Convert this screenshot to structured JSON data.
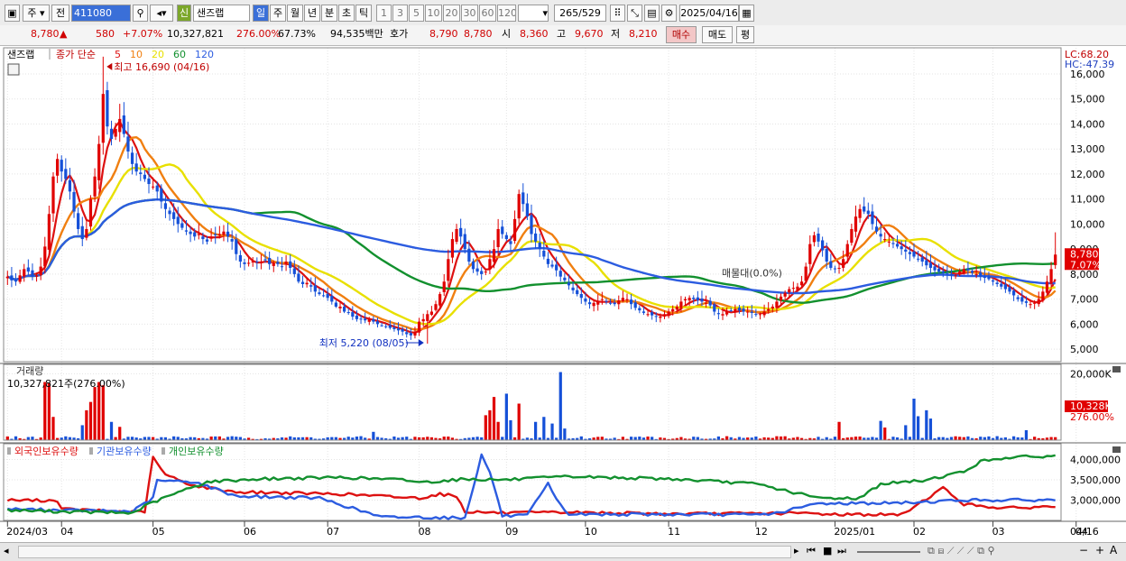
{
  "toolbar": {
    "market_label": "주",
    "prev_label": "전",
    "code": "411080",
    "new_badge": "신",
    "stock_name": "샌즈랩",
    "periods": [
      "일",
      "주",
      "월",
      "년",
      "분",
      "초",
      "틱"
    ],
    "active_period": "일",
    "intervals": [
      "1",
      "3",
      "5",
      "10",
      "20",
      "30",
      "60",
      "120"
    ],
    "count_value": "265",
    "count_total": "/529",
    "date_value": "2025/04/16"
  },
  "quote": {
    "price": "8,780",
    "up_arrow": "▲",
    "change": "580",
    "change_pct": "+7.07%",
    "volume": "10,327,821",
    "volume_ratio": "276.00%",
    "turnover": "67.73%",
    "amount": "94,535백만",
    "hoga_label": "호가",
    "ask": "8,790",
    "bid": "8,780",
    "open_label": "시",
    "open": "8,360",
    "high_label": "고",
    "high": "9,670",
    "low_label": "저",
    "low": "8,210",
    "buy_label": "매수",
    "sell_label": "매도",
    "eval_label": "평"
  },
  "chart_data": {
    "type": "candlestick",
    "price_panel": {
      "stock_label": "샌즈랩",
      "legend_prefix": "종가 단순",
      "ma_periods": [
        "5",
        "10",
        "20",
        "60",
        "120"
      ],
      "ma_colors": [
        "#dd1111",
        "#f07f10",
        "#e8e000",
        "#12902e",
        "#2c5ce0"
      ],
      "ylim": [
        4500,
        16900
      ],
      "yticks": [
        {
          "v": 5000,
          "l": "5,000"
        },
        {
          "v": 6000,
          "l": "6,000"
        },
        {
          "v": 7000,
          "l": "7,000"
        },
        {
          "v": 8000,
          "l": "8,000"
        },
        {
          "v": 9000,
          "l": "9,000"
        },
        {
          "v": 10000,
          "l": "10,000"
        },
        {
          "v": 11000,
          "l": "11,000"
        },
        {
          "v": 12000,
          "l": "12,000"
        },
        {
          "v": 13000,
          "l": "13,000"
        },
        {
          "v": 14000,
          "l": "14,000"
        },
        {
          "v": 15000,
          "l": "15,000"
        },
        {
          "v": 16000,
          "l": "16,000"
        }
      ],
      "lc_label": "LC:68.20",
      "hc_label": "HC:-47.39",
      "high_annotation": {
        "text": "최고 16,690 (04/16)",
        "value": 16690,
        "index": 23
      },
      "low_annotation": {
        "text": "최저 5,220 (08/05)",
        "value": 5220,
        "index": 101
      },
      "current_price_label": "8,780",
      "current_pct_label": "7.07%",
      "vwap_label": "매물대(0.0%)",
      "close_series": [
        7900,
        7750,
        7700,
        7950,
        8200,
        8100,
        7900,
        7950,
        8300,
        9100,
        10400,
        11900,
        12600,
        12100,
        11800,
        11300,
        10500,
        9800,
        9400,
        9800,
        11000,
        11900,
        13200,
        15200,
        13900,
        13400,
        13800,
        14200,
        13600,
        12900,
        12400,
        12100,
        12000,
        11800,
        11600,
        11500,
        11300,
        10900,
        10600,
        10400,
        10200,
        10000,
        9850,
        9700,
        9600,
        9500,
        9600,
        9400,
        9300,
        9500,
        9550,
        9600,
        9700,
        9500,
        9300,
        8800,
        8500,
        8400,
        8450,
        8500,
        8480,
        8500,
        8550,
        8400,
        8450,
        8400,
        8300,
        8500,
        8250,
        8000,
        7700,
        7600,
        7650,
        7500,
        7300,
        7200,
        7150,
        7050,
        6900,
        6700,
        6700,
        6500,
        6450,
        6300,
        6200,
        6200,
        6150,
        6200,
        6100,
        6000,
        5950,
        5900,
        5850,
        5800,
        5750,
        5700,
        5600,
        5550,
        5700,
        6100,
        6200,
        6400,
        6500,
        6800,
        7200,
        7700,
        8600,
        9400,
        9800,
        9500,
        9000,
        8500,
        8200,
        8100,
        8000,
        8100,
        8600,
        9000,
        9800,
        9600,
        9400,
        9200,
        10200,
        11200,
        10800,
        10300,
        9600,
        9300,
        9000,
        8700,
        8400,
        8300,
        8150,
        7900,
        7750,
        7550,
        7350,
        7200,
        7050,
        6900,
        6800,
        6850,
        6900,
        7000,
        6900,
        6850,
        6800,
        6950,
        7050,
        7000,
        6800,
        6650,
        6550,
        6450,
        6400,
        6350,
        6300,
        6300,
        6400,
        6500,
        6600,
        6700,
        6900,
        7000,
        7050,
        7000,
        6950,
        6900,
        6850,
        6750,
        6500,
        6400,
        6400,
        6500,
        6550,
        6600,
        6550,
        6500,
        6500,
        6450,
        6400,
        6400,
        6500,
        6600,
        6700,
        6900,
        7100,
        7250,
        7400,
        7450,
        7500,
        7700,
        8300,
        9200,
        9550,
        9300,
        8950,
        8500,
        8250,
        8200,
        8250,
        8600,
        9200,
        9800,
        10300,
        10600,
        10500,
        10400,
        10000,
        9700,
        9500,
        9400,
        9300,
        9200,
        9100,
        9000,
        8900,
        8800,
        8700,
        8600,
        8500,
        8350,
        8250,
        8150,
        8100,
        8050,
        8000,
        7950,
        7950,
        8100,
        8200,
        8150,
        8050,
        8000,
        7900,
        7850,
        7800,
        7700,
        7600,
        7500,
        7400,
        7300,
        7150,
        7000,
        6900,
        6850,
        6800,
        6850,
        7000,
        7300,
        7700,
        8200,
        8780
      ],
      "x_labels": [
        {
          "label": "2024/03",
          "index": 0
        },
        {
          "label": "04",
          "index": 13
        },
        {
          "label": "05",
          "index": 35
        },
        {
          "label": "06",
          "index": 57
        },
        {
          "label": "07",
          "index": 77
        },
        {
          "label": "08",
          "index": 99
        },
        {
          "label": "09",
          "index": 120
        },
        {
          "label": "10",
          "index": 139
        },
        {
          "label": "11",
          "index": 159
        },
        {
          "label": "12",
          "index": 180
        },
        {
          "label": "2025/01",
          "index": 199
        },
        {
          "label": "02",
          "index": 218
        },
        {
          "label": "03",
          "index": 237
        },
        {
          "label": "04",
          "index": 257
        }
      ],
      "x_labels_right": [
        "04/16"
      ]
    },
    "volume_panel": {
      "title": "거래량",
      "info": "10,327,821주(276.00%)",
      "ylim": [
        0,
        22000
      ],
      "ytick": "20,000K",
      "current_label": "10,328K",
      "current_pct": "276.00%",
      "spikes": [
        {
          "i": 9,
          "v": 17500
        },
        {
          "i": 10,
          "v": 17200
        },
        {
          "i": 11,
          "v": 7000
        },
        {
          "i": 18,
          "v": 4500
        },
        {
          "i": 19,
          "v": 9000
        },
        {
          "i": 20,
          "v": 11500
        },
        {
          "i": 21,
          "v": 16000
        },
        {
          "i": 22,
          "v": 17500
        },
        {
          "i": 23,
          "v": 16500
        },
        {
          "i": 25,
          "v": 5500
        },
        {
          "i": 27,
          "v": 4000
        },
        {
          "i": 88,
          "v": 2500
        },
        {
          "i": 115,
          "v": 7500
        },
        {
          "i": 116,
          "v": 9000
        },
        {
          "i": 117,
          "v": 13000
        },
        {
          "i": 118,
          "v": 5500
        },
        {
          "i": 120,
          "v": 14000
        },
        {
          "i": 121,
          "v": 6000
        },
        {
          "i": 123,
          "v": 11000
        },
        {
          "i": 127,
          "v": 5500
        },
        {
          "i": 129,
          "v": 7000
        },
        {
          "i": 131,
          "v": 5000
        },
        {
          "i": 133,
          "v": 20500
        },
        {
          "i": 134,
          "v": 3500
        },
        {
          "i": 200,
          "v": 5500
        },
        {
          "i": 210,
          "v": 5800
        },
        {
          "i": 211,
          "v": 3800
        },
        {
          "i": 216,
          "v": 4500
        },
        {
          "i": 218,
          "v": 12500
        },
        {
          "i": 219,
          "v": 7200
        },
        {
          "i": 221,
          "v": 9000
        },
        {
          "i": 222,
          "v": 6500
        },
        {
          "i": 245,
          "v": 3000
        },
        {
          "i": 264,
          "v": 10328
        }
      ]
    },
    "holding_panel": {
      "series_names": [
        "외국인보유수량",
        "기관보유수량",
        "개인보유수량"
      ],
      "colors": [
        "#dd1111",
        "#2c5ce0",
        "#12902e"
      ],
      "ylim": [
        2500000,
        4300000
      ],
      "yticks": [
        {
          "v": 3000000,
          "l": "3,000,000"
        },
        {
          "v": 3500000,
          "l": "3,500,000"
        },
        {
          "v": 4000000,
          "l": "4,000,000"
        }
      ]
    }
  },
  "scrollbar": {
    "zoom_minus": "−",
    "zoom_plus": "+",
    "text_tool": "A"
  }
}
